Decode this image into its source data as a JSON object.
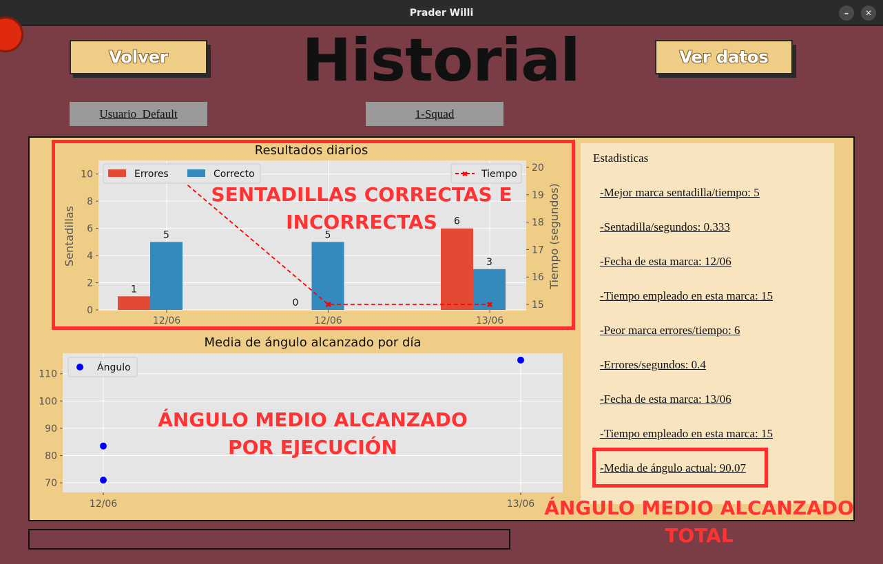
{
  "window": {
    "title": "Prader Willi",
    "minimize_glyph": "–",
    "close_glyph": "✕"
  },
  "header": {
    "back_label": "Volver",
    "title": "Historial",
    "view_data_label": "Ver datos",
    "user": "Usuario_Default",
    "exercise": "1-Squad"
  },
  "stats": {
    "title": "Estadisticas",
    "best_reps_time": "-Mejor marca sentadilla/tiempo:  5",
    "reps_per_second": "-Sentadilla/segundos:  0.333",
    "best_date": "-Fecha de esta marca:  12/06",
    "best_time_used": "-Tiempo empleado en esta marca:  15",
    "worst_errors_time": "-Peor marca errores/tiempo:  6",
    "errors_per_second": "-Errores/segundos:  0.4",
    "worst_date": "-Fecha de esta marca:  13/06",
    "worst_time_used": "-Tiempo empleado en esta marca:  15",
    "current_angle_avg": "-Media de ángulo actual:  90.07"
  },
  "annotations": {
    "chart1": [
      "SENTADILLAS CORRECTAS E",
      "INCORRECTAS"
    ],
    "chart2": [
      "ÁNGULO MEDIO ALCANZADO",
      "POR EJECUCIÓN"
    ],
    "total": [
      "ÁNGULO MEDIO ALCANZADO",
      "TOTAL"
    ],
    "color": "#ff3333"
  },
  "chart_data": [
    {
      "type": "bar",
      "title": "Resultados diarios",
      "categories": [
        "12/06",
        "12/06",
        "13/06"
      ],
      "series": [
        {
          "name": "Errores",
          "values": [
            1,
            0,
            6
          ],
          "color": "#e24a33"
        },
        {
          "name": "Correcto",
          "values": [
            5,
            5,
            3
          ],
          "color": "#348abd"
        }
      ],
      "ylabel": "Sentadillas",
      "ylim": [
        0,
        11
      ],
      "yticks": [
        0,
        2,
        4,
        6,
        8,
        10
      ],
      "secondary": {
        "type": "line",
        "name": "Tiempo",
        "values": [
          20,
          15,
          15
        ],
        "ylabel": "Tiempo (segundos)",
        "ylim": [
          14.8,
          20.25
        ],
        "yticks": [
          15,
          16,
          17,
          18,
          19,
          20
        ],
        "color": "#ff0000"
      },
      "legend": "top-left",
      "secondary_legend": "top-right",
      "grid": true
    },
    {
      "type": "scatter",
      "title": "Media de ángulo alcanzado por día",
      "series": [
        {
          "name": "Ángulo",
          "x": [
            "12/06",
            "12/06",
            "13/06"
          ],
          "y": [
            83.5,
            71,
            115
          ],
          "color": "#0000ff"
        }
      ],
      "xticks": [
        "12/06",
        "13/06"
      ],
      "yticks": [
        70,
        80,
        90,
        100,
        110
      ],
      "ylim": [
        66.5,
        117.5
      ],
      "legend": "top-left",
      "grid": true
    }
  ]
}
